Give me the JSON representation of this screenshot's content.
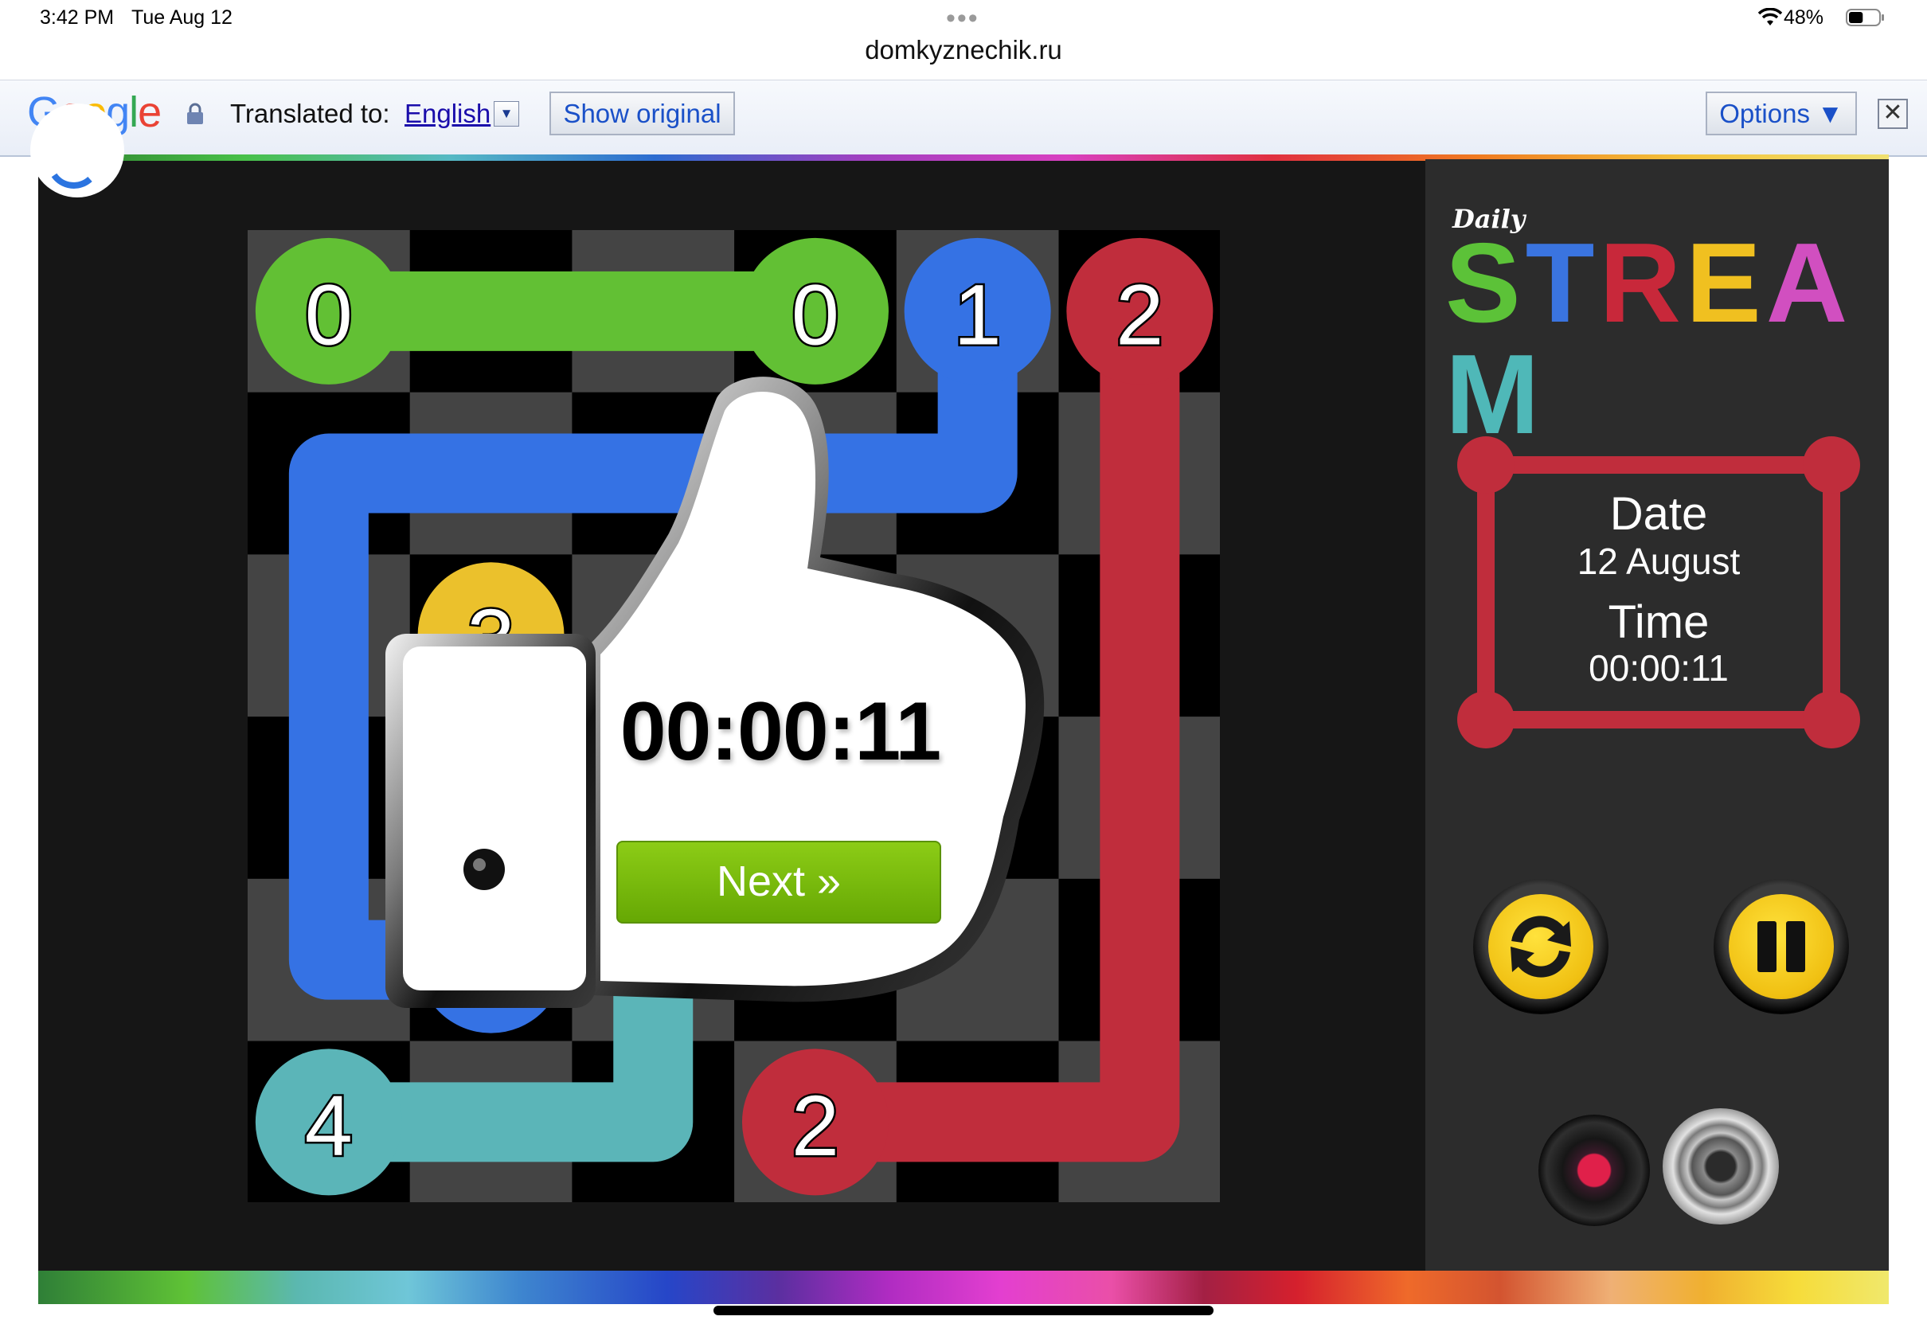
{
  "status_bar": {
    "time": "3:42 PM",
    "date": "Tue Aug 12",
    "dots": "•••",
    "url": "domkyznechik.ru",
    "battery_percent": "48%",
    "battery_level": 0.48
  },
  "translate_bar": {
    "logo": [
      "G",
      "o",
      "o",
      "g",
      "l",
      "e"
    ],
    "logo_colors": [
      "#4285f4",
      "#ea4335",
      "#fbbc05",
      "#4285f4",
      "#34a853",
      "#ea4335"
    ],
    "translated_to_label": "Translated to:",
    "language": "English",
    "dropdown_glyph": "▼",
    "show_original_label": "Show original",
    "options_label": "Options ▼",
    "close_glyph": "✕"
  },
  "game": {
    "grid": {
      "cols": 6,
      "rows": 6
    },
    "colors": {
      "green": "#62c034",
      "blue": "#3572e4",
      "red": "#c02d3c",
      "teal": "#5bb5b8",
      "yellow": "#ebc12c",
      "cell_dark": "#000000",
      "cell_light": "#444444"
    },
    "endpoints": [
      {
        "label": "0",
        "color": "green",
        "col": 0,
        "row": 0
      },
      {
        "label": "0",
        "color": "green",
        "col": 3,
        "row": 0
      },
      {
        "label": "1",
        "color": "blue",
        "col": 4,
        "row": 0
      },
      {
        "label": "2",
        "color": "red",
        "col": 5,
        "row": 0
      },
      {
        "label": "3",
        "color": "yellow",
        "col": 1,
        "row": 2
      },
      {
        "label": "1",
        "color": "blue",
        "col": 1,
        "row": 4
      },
      {
        "label": "4",
        "color": "teal",
        "col": 0,
        "row": 5
      },
      {
        "label": "2",
        "color": "red",
        "col": 3,
        "row": 5
      }
    ],
    "paths": [
      {
        "color": "green",
        "cells": [
          [
            0,
            0
          ],
          [
            1,
            0
          ],
          [
            2,
            0
          ],
          [
            3,
            0
          ]
        ]
      },
      {
        "color": "blue",
        "cells": [
          [
            4,
            0
          ],
          [
            4,
            1
          ],
          [
            3,
            1
          ],
          [
            2,
            1
          ],
          [
            1,
            1
          ],
          [
            0,
            1
          ],
          [
            0,
            2
          ],
          [
            0,
            3
          ],
          [
            0,
            4
          ],
          [
            1,
            4
          ]
        ]
      },
      {
        "color": "red",
        "cells": [
          [
            5,
            0
          ],
          [
            5,
            1
          ],
          [
            5,
            2
          ],
          [
            5,
            3
          ],
          [
            5,
            4
          ],
          [
            5,
            5
          ],
          [
            4,
            5
          ],
          [
            3,
            5
          ]
        ]
      },
      {
        "color": "teal",
        "cells": [
          [
            0,
            5
          ],
          [
            1,
            5
          ],
          [
            2,
            5
          ],
          [
            2,
            4
          ]
        ]
      }
    ]
  },
  "side_panel": {
    "logo_daily": "Daily",
    "logo_letters": [
      "S",
      "T",
      "R",
      "E",
      "A",
      "M"
    ],
    "logo_colors": [
      "#5cc238",
      "#3a74e0",
      "#c8283a",
      "#f0c020",
      "#d14fc0",
      "#4fb8b8"
    ],
    "date_label": "Date",
    "date_value": "12 August",
    "time_label": "Time",
    "time_value": "00:00:11",
    "frame_color": "#c02d3c"
  },
  "popup": {
    "time": "00:00:11",
    "next_label": "Next »"
  },
  "icons": {
    "refresh": "refresh-icon",
    "pause": "pause-icon",
    "music": "record-icon",
    "sound": "speaker-icon"
  }
}
